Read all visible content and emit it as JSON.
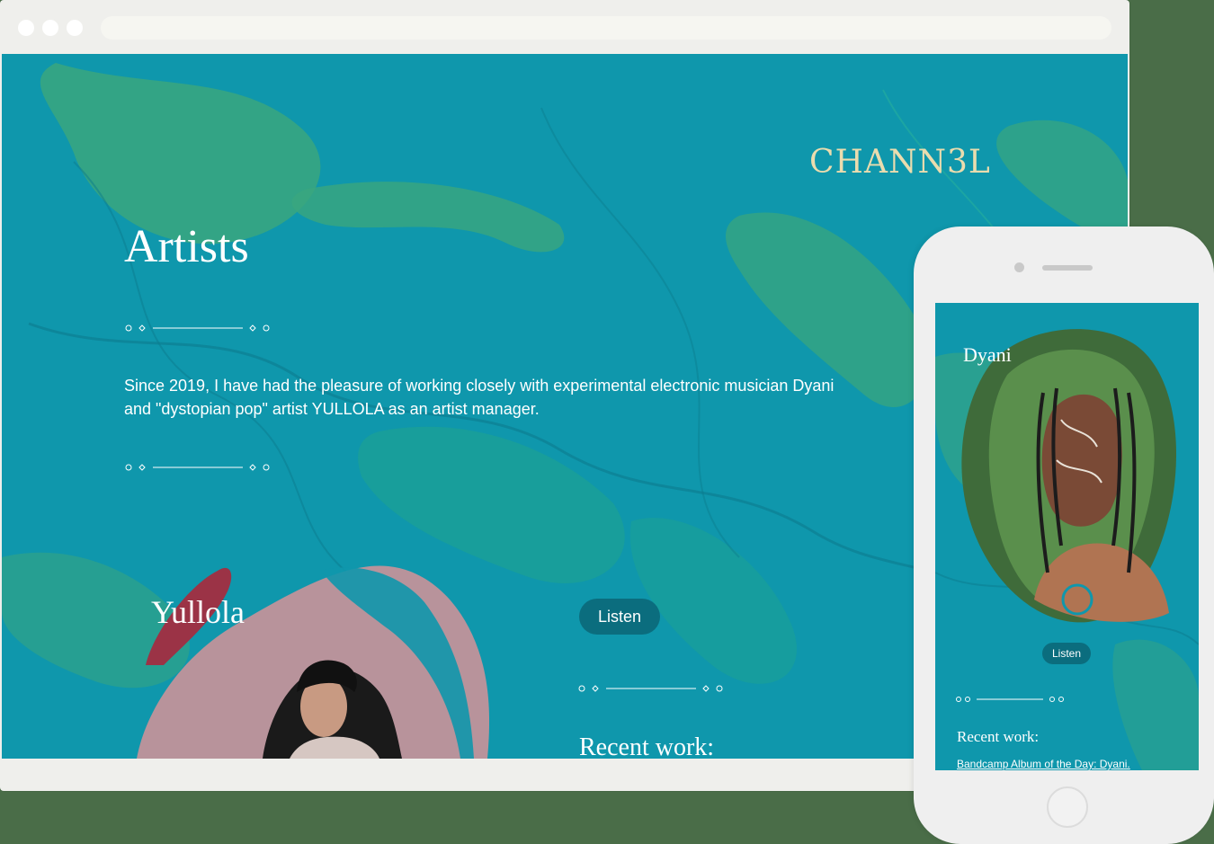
{
  "colors": {
    "page_background": "#4a6d48",
    "site_teal": "#0f97ac",
    "marble_green": "#3aa67e",
    "button_teal": "#0b6d7e",
    "logo_gold": "#eadcae"
  },
  "desktop": {
    "logo": "CHANN3L",
    "heading": "Artists",
    "intro": "Since 2019, I have had the pleasure of working closely with experimental electronic musician Dyani and \"dystopian pop\" artist YULLOLA as an artist manager.",
    "featured_artist": {
      "name": "Yullola",
      "listen_label": "Listen",
      "recent_work_label": "Recent work:"
    }
  },
  "mobile": {
    "featured_artist": {
      "name": "Dyani",
      "listen_label": "Listen",
      "recent_work_label": "Recent work:",
      "recent_item": "Bandcamp Album of the Day: Dyani."
    }
  }
}
